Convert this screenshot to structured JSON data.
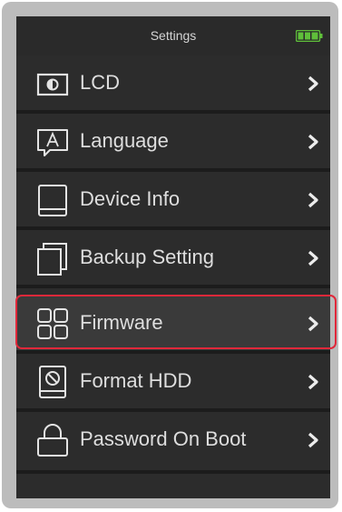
{
  "header": {
    "title": "Settings",
    "battery_icon": "battery-full-icon",
    "battery_color": "#5fbf3a"
  },
  "menu": {
    "items": [
      {
        "label": "LCD",
        "icon": "brightness-icon"
      },
      {
        "label": "Language",
        "icon": "language-icon"
      },
      {
        "label": "Device Info",
        "icon": "device-icon"
      },
      {
        "label": "Backup Setting",
        "icon": "backup-icon"
      },
      {
        "label": "Firmware",
        "icon": "firmware-icon",
        "selected": true
      },
      {
        "label": "Format HDD",
        "icon": "format-hdd-icon"
      },
      {
        "label": "Password On Boot",
        "icon": "lock-icon"
      }
    ]
  },
  "colors": {
    "screen_bg": "#2c2c2c",
    "text": "#dedede",
    "highlight": "#e0283a"
  }
}
